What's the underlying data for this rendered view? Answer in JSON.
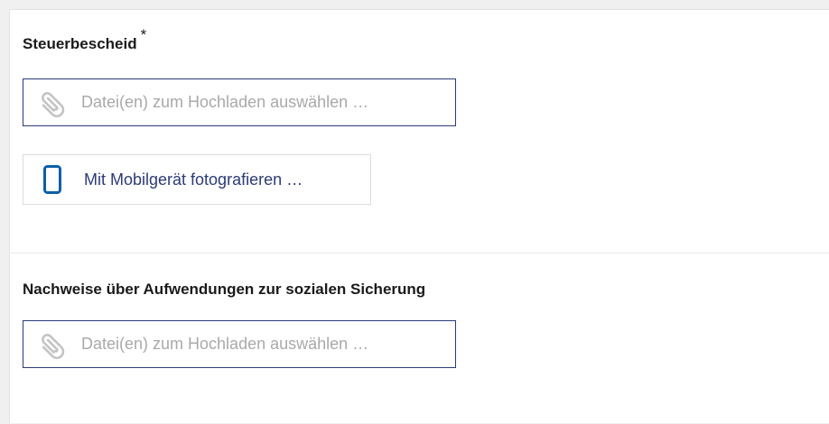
{
  "colors": {
    "accent": "#2b3b78",
    "placeholder": "#a9a9a9",
    "icon_gray": "#c4c4c4",
    "phone_blue": "#0a5fa8"
  },
  "fields": [
    {
      "label": "Steuerbescheid",
      "required_mark": "*",
      "upload_placeholder": "Datei(en) zum Hochladen auswählen …",
      "upload_icon": "paperclip-icon",
      "mobile_button_label": "Mit Mobilgerät fotografieren …",
      "mobile_icon": "smartphone-icon"
    },
    {
      "label": "Nachweise über Aufwendungen zur sozialen Sicherung",
      "upload_placeholder": "Datei(en) zum Hochladen auswählen …",
      "upload_icon": "paperclip-icon"
    }
  ]
}
